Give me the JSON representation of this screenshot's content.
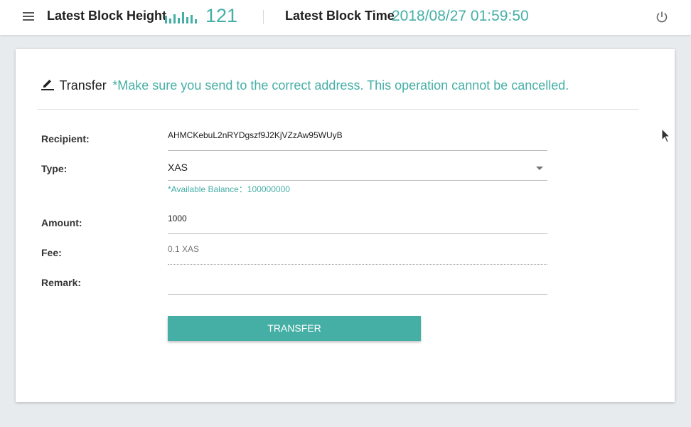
{
  "header": {
    "menu_icon": "hamburger-menu-icon",
    "block_height_label": "Latest Block Height",
    "block_height_icon": "bar-chart-icon",
    "block_height_value": "121",
    "block_time_label": "Latest Block Time",
    "block_time_value": "2018/08/27 01:59:50",
    "power_icon": "power-icon",
    "accent_color": "#45afa6"
  },
  "card": {
    "title_icon": "edit-icon",
    "title": "Transfer",
    "warning": "*Make sure you send to the correct address. This operation cannot be cancelled."
  },
  "form": {
    "recipient": {
      "label": "Recipient:",
      "value": "AHMCKebuL2nRYDgszf9J2KjVZzAw95WUyB"
    },
    "type": {
      "label": "Type:",
      "value": "XAS",
      "hint": "*Available Balance：100000000"
    },
    "amount": {
      "label": "Amount:",
      "value": "1000"
    },
    "fee": {
      "label": "Fee:",
      "value": "0.1 XAS"
    },
    "remark": {
      "label": "Remark:",
      "value": ""
    },
    "submit_label": "TRANSFER"
  }
}
